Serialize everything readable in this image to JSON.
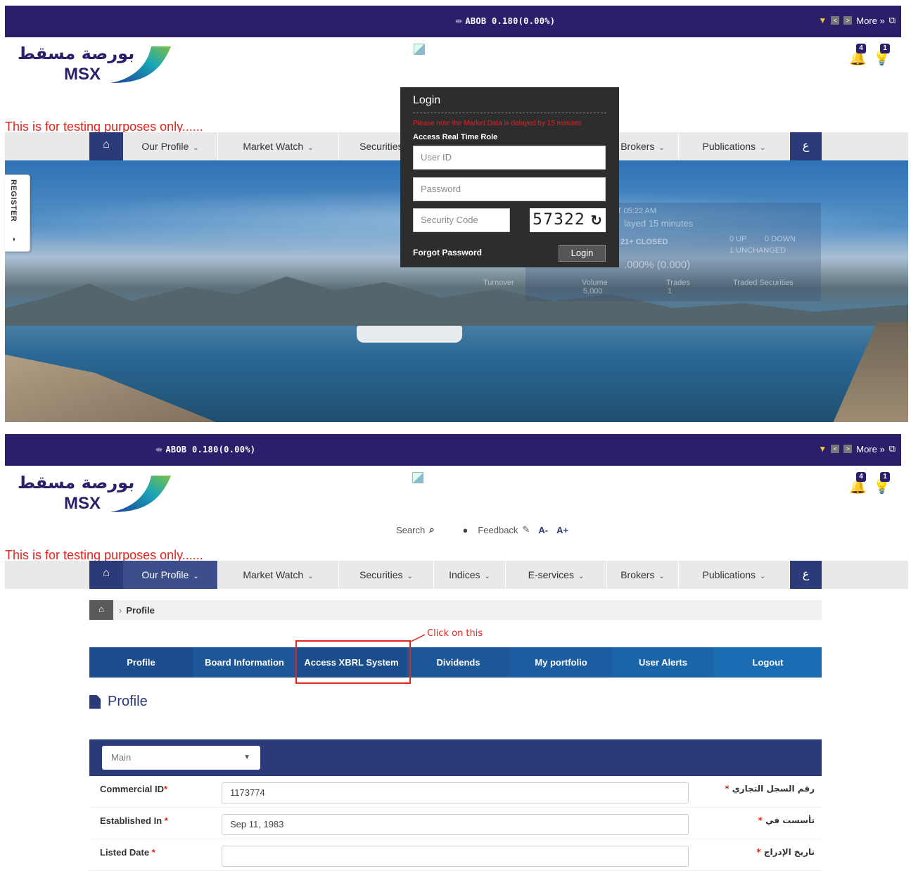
{
  "ticker": {
    "symbol": "ABOB 0.180(0.00%)",
    "more_label": "More »"
  },
  "logo": {
    "arabic": "بورصة مسقط",
    "english": "MSX"
  },
  "notifications": {
    "alerts_count": "4",
    "tips_count": "1"
  },
  "testing_banner": "This is for testing purposes only......",
  "nav": {
    "items": [
      "Our Profile",
      "Market Watch",
      "Securities",
      "Indices",
      "E-services",
      "Brokers",
      "Publications"
    ],
    "lang_label": "ع"
  },
  "register_tab": "REGISTER",
  "login": {
    "title": "Login",
    "delay_note": "Please note the Market Data is delayed by 15 minutes",
    "role_label": "Access Real Time Role",
    "userid_placeholder": "User ID",
    "password_placeholder": "Password",
    "security_placeholder": "Security Code",
    "captcha": "57322",
    "forgot_label": "Forgot Password",
    "login_button": "Login"
  },
  "hero_overlay": {
    "time": "T 05:22 AM",
    "delay": "layed 15 minutes",
    "status": "21+ CLOSED",
    "up": "0 UP",
    "down": "0 DOWN",
    "unchanged": "1 UNCHANGED",
    "change": ".000% (0.000)",
    "turnover_label": "Turnover",
    "volume_label": "Volume",
    "volume_value": "5,000",
    "trades_label": "Trades",
    "trades_value": "1",
    "traded_label": "Traded Securities"
  },
  "header_tools": {
    "search_label": "Search",
    "feedback_label": "Feedback",
    "font_minus": "A-",
    "font_plus": "A+"
  },
  "breadcrumb": {
    "current": "Profile"
  },
  "hint": "Click on this",
  "profile_tabs": [
    "Profile",
    "Board Information",
    "Access XBRL System",
    "Dividends",
    "My portfolio",
    "User Alerts",
    "Logout"
  ],
  "page_title": "Profile",
  "section_select": "Main",
  "fields": [
    {
      "label": "Commercial ID",
      "value": "1173774",
      "arabic": "رقم السجل التجاري"
    },
    {
      "label": "Established In ",
      "value": "Sep 11, 1983",
      "arabic": "تأسست في"
    },
    {
      "label": "Listed Date ",
      "value": "",
      "arabic": "تاريخ الإدراج"
    }
  ],
  "colors": {
    "brand_navy": "#2b1f6b",
    "nav_blue": "#2b3a78",
    "tab_blue": "#1a5fa8",
    "alert_red": "#e2241d",
    "bell_gold": "#e6a61b"
  }
}
